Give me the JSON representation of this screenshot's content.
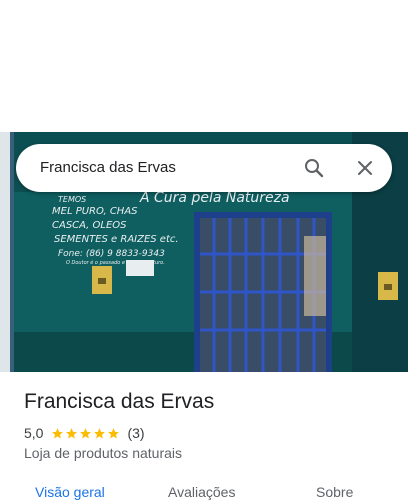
{
  "search": {
    "query": "Francisca das Ervas"
  },
  "photo_sign": {
    "slogan": "A Cura pela Natureza",
    "lines": [
      "TEMOS",
      "MEL PURO, CHAS",
      "CASCA, OLEOS",
      "SEMENTES e RAIZES etc.",
      "Fone: (86) 9 8833-9343",
      "O Doutor é o passado e a vida o futuro."
    ]
  },
  "place": {
    "name": "Francisca das Ervas",
    "rating": "5,0",
    "stars": 5,
    "review_count": "(3)",
    "category": "Loja de produtos naturais"
  },
  "tabs": [
    {
      "label": "Visão geral",
      "active": true
    },
    {
      "label": "Avaliações",
      "active": false
    },
    {
      "label": "Sobre",
      "active": false
    }
  ],
  "colors": {
    "accent": "#1a73e8",
    "star": "#fbbc04",
    "wall": "#0f5e60"
  },
  "icons": {
    "search": "search-icon",
    "close": "close-icon",
    "star": "star-icon"
  }
}
